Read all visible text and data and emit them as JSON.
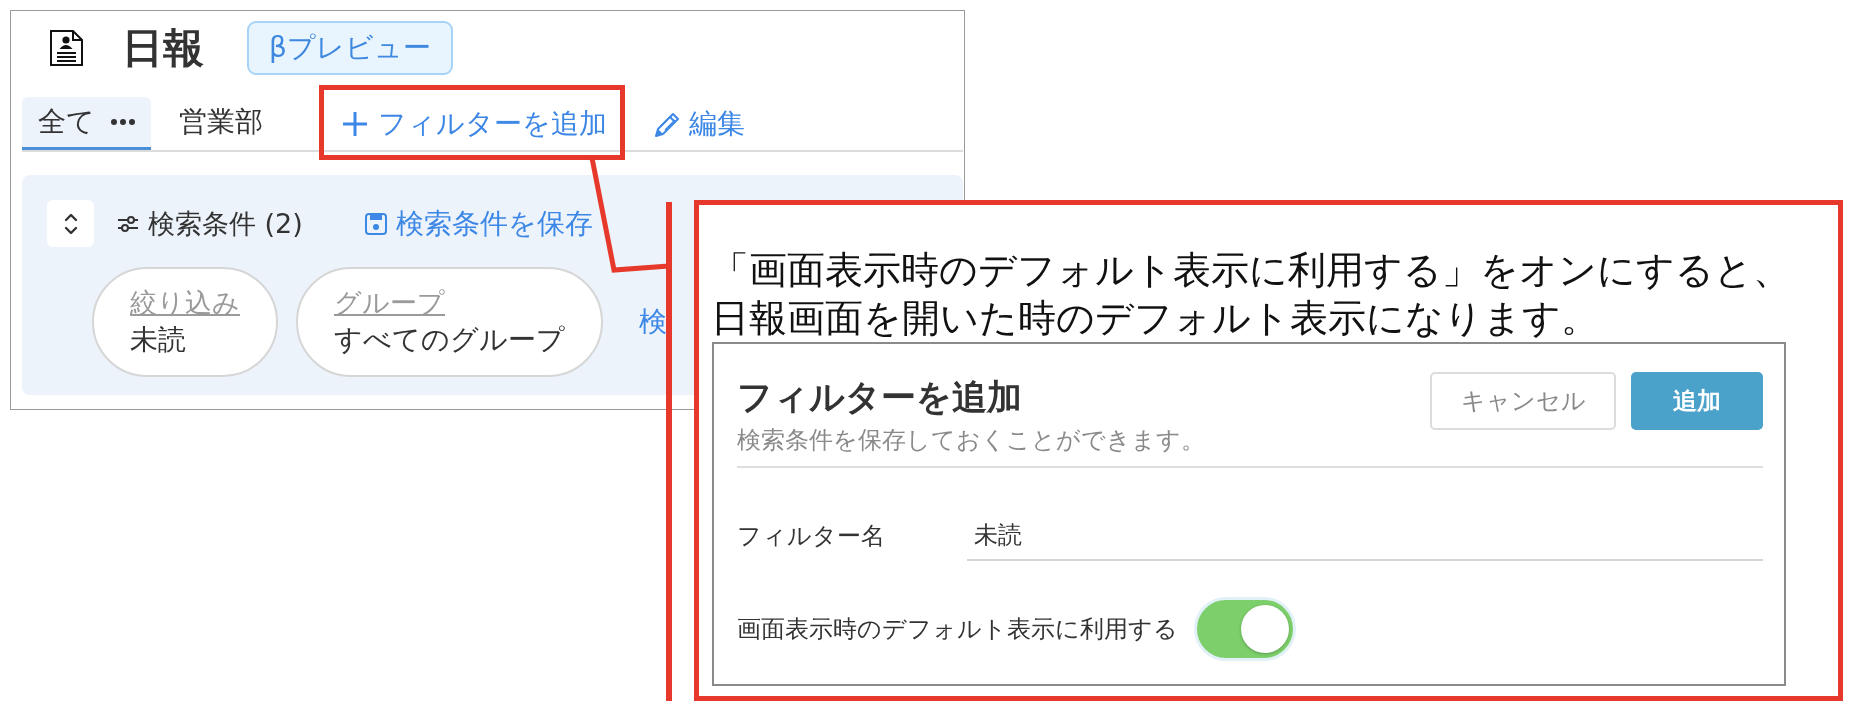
{
  "header": {
    "title": "日報",
    "badge": "βプレビュー"
  },
  "tabs": [
    {
      "label": "全て",
      "has_menu": true,
      "selected": true
    },
    {
      "label": "営業部",
      "has_menu": false,
      "selected": false
    }
  ],
  "actions": [
    {
      "kind": "add",
      "label": "フィルターを追加",
      "highlighted": true
    },
    {
      "kind": "edit",
      "label": "編集",
      "highlighted": false
    }
  ],
  "search_panel": {
    "title": "検索条件 (2)",
    "save_link": "検索条件を保存",
    "chips": [
      {
        "label": "絞り込み",
        "value": "未読"
      },
      {
        "label": "グループ",
        "value": "すべてのグループ"
      }
    ],
    "link": "検"
  },
  "callout": {
    "text": "「画面表示時のデフォルト表示に利用する」をオンにすると、日報画面を開いた時のデフォルト表示になります。"
  },
  "dialog": {
    "title": "フィルターを追加",
    "subtitle": "検索条件を保存しておくことができます。",
    "buttons": [
      {
        "kind": "secondary",
        "label": "キャンセル"
      },
      {
        "kind": "primary",
        "label": "追加"
      }
    ],
    "fields": [
      {
        "kind": "text",
        "label": "フィルター名",
        "value": "未読"
      },
      {
        "kind": "toggle",
        "label": "画面表示時のデフォルト表示に利用する",
        "on": true
      }
    ]
  }
}
